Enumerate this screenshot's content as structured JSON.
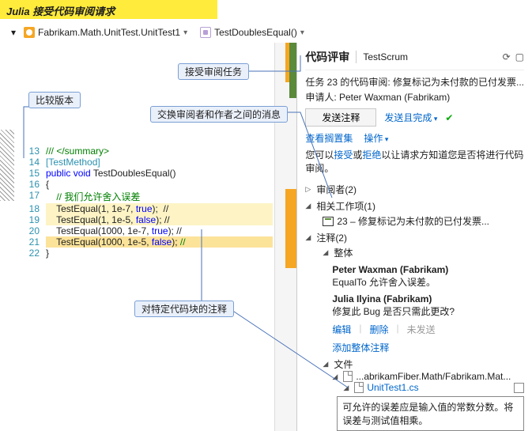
{
  "banner": "Julia 接受代码审阅请求",
  "tabs": {
    "file": "Fabrikam.Math.UnitTest.UnitTest1",
    "method": "TestDoublesEqual()"
  },
  "callouts": {
    "accept": "接受审阅任务",
    "compare": "比较版本",
    "exchange": "交换审阅者和作者之间的消息",
    "block": "对特定代码块的注释"
  },
  "code": {
    "lines": [
      {
        "n": 13,
        "t": "/// </summary>",
        "cls": "c-green"
      },
      {
        "n": 14,
        "t": "[TestMethod]",
        "cls": "c-cyan"
      },
      {
        "n": 15,
        "pre": "public void ",
        "mid": "TestDoublesEqual()",
        "pcls": "c-blue"
      },
      {
        "n": 16,
        "t": "{"
      },
      {
        "n": 17,
        "t": "    // 我们允许舍入误差",
        "cls": "c-green"
      },
      {
        "n": 18,
        "c": "    TestEqual(1, 1e-7, ",
        "kw": "true",
        "tail": ");  //",
        "hl": "hl"
      },
      {
        "n": 19,
        "c": "    TestEqual(1, 1e-5, ",
        "kw": "false",
        "tail": "); //",
        "hl": "hl"
      },
      {
        "n": 20,
        "c": "    TestEqual(1000, 1e-7, ",
        "kw": "true",
        "tail": "); //",
        "hl": ""
      },
      {
        "n": 21,
        "c": "    TestEqual(1000, 1e-5, ",
        "kw": "false",
        "tail": ");",
        "post": " //",
        "hl": "hl sel"
      },
      {
        "n": 22,
        "t": "}"
      }
    ]
  },
  "panel": {
    "title": "代码评审",
    "proj": "TestScrum",
    "task": "任务 23 的代码审阅: 修复标记为未付款的已付发票...",
    "requester_lbl": "申请人: ",
    "requester": "Peter Waxman (Fabrikam)",
    "send_btn": "发送注释",
    "send_done": "发送且完成",
    "view_shelve": "查看搁置集",
    "actions_menu": "操作",
    "accept_pre": "您可以",
    "accept": "接受",
    "or": "或",
    "reject": "拒绝",
    "accept_post": "以让请求方知道您是否将进行代码审阅。",
    "reviewers": "审阅者(2)",
    "workitems": "相关工作项(1)",
    "workitem_text": "23 – 修复标记为未付款的已付发票...",
    "comments": "注释(2)",
    "overall": "整体",
    "c1_auth": "Peter Waxman (Fabrikam)",
    "c1_body": "EqualTo 允许舍入误差。",
    "c2_auth": "Julia Ilyina (Fabrikam)",
    "c2_body": "修复此 Bug 是否只需此更改?",
    "edit": "编辑",
    "del": "删除",
    "unsent": "未发送",
    "add_overall": "添加整体注释",
    "files": "文件",
    "file_path": "...abrikamFiber.Math/Fabrikam.Mat...",
    "file_name": "UnitTest1.cs",
    "tip": "可允许的误差应是输入值的常数分数。将误差与测试值相乘。"
  }
}
